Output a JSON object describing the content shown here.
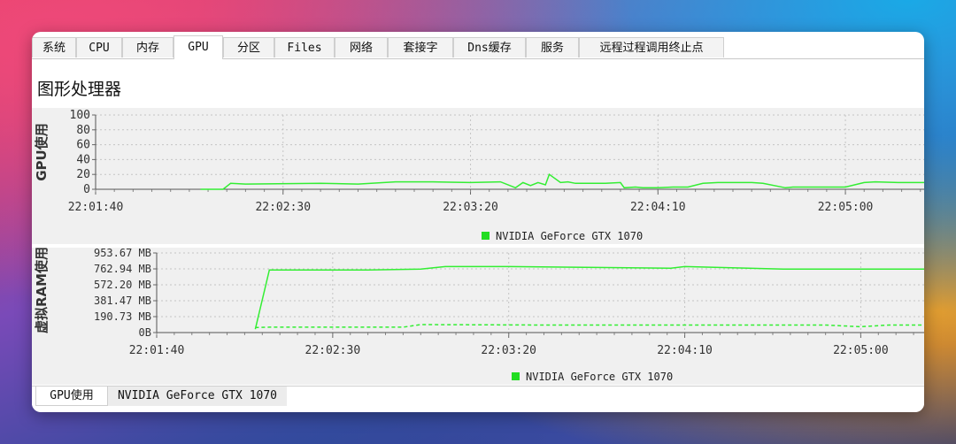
{
  "tabs": [
    {
      "label": "系统"
    },
    {
      "label": "CPU"
    },
    {
      "label": "内存"
    },
    {
      "label": "GPU"
    },
    {
      "label": "分区"
    },
    {
      "label": "Files"
    },
    {
      "label": "网络"
    },
    {
      "label": "套接字"
    },
    {
      "label": "Dns缓存"
    },
    {
      "label": "服务"
    },
    {
      "label": "远程过程调用终止点"
    }
  ],
  "active_tab": "GPU",
  "page_title": "图形处理器",
  "bottom_tabs": [
    {
      "label": "GPU使用"
    },
    {
      "label": "NVIDIA GeForce GTX 1070"
    }
  ],
  "colors": {
    "series_line": "#33ee33",
    "legend_marker": "#22dd22",
    "panel_bg": "#f0f0f0",
    "grid": "#c4c4c4"
  },
  "chart_data": [
    {
      "type": "line",
      "ylabel": "GPU使用",
      "y_ticks": [
        "100",
        "80",
        "60",
        "40",
        "20",
        "0"
      ],
      "ylim": [
        0,
        100
      ],
      "x_ticks": [
        "22:01:40",
        "22:02:30",
        "22:03:20",
        "22:04:10",
        "22:05:00"
      ],
      "x_tick_seconds": [
        0,
        50,
        100,
        150,
        200
      ],
      "xlim": [
        0,
        221
      ],
      "grid": true,
      "legend_position": "bottom-center",
      "series": [
        {
          "name": "NVIDIA GeForce GTX 1070",
          "style": "solid",
          "x": [
            28,
            34,
            36,
            40,
            60,
            70,
            80,
            90,
            100,
            108,
            112,
            114,
            116,
            118,
            120,
            121,
            124,
            126,
            128,
            136,
            140,
            141,
            144,
            146,
            150,
            154,
            158,
            162,
            166,
            170,
            175,
            178,
            184,
            186,
            190,
            200,
            205,
            208,
            214,
            221
          ],
          "y": [
            0,
            0,
            8,
            7,
            8,
            7,
            10,
            10,
            9,
            10,
            2,
            9,
            5,
            9,
            6,
            20,
            9,
            10,
            8,
            8,
            9,
            2,
            3,
            2,
            2,
            3,
            3,
            8,
            9,
            9,
            9,
            8,
            2,
            3,
            3,
            3,
            9,
            10,
            9,
            9
          ]
        }
      ]
    },
    {
      "type": "line",
      "ylabel": "虚拟RAM使用",
      "y_ticks": [
        "953.67 MB",
        "762.94 MB",
        "572.20 MB",
        "381.47 MB",
        "190.73 MB",
        "0B"
      ],
      "ylim": [
        0,
        953.67
      ],
      "ylim_unit": "MB",
      "x_ticks": [
        "22:01:40",
        "22:02:30",
        "22:03:20",
        "22:04:10",
        "22:05:00"
      ],
      "x_tick_seconds": [
        0,
        50,
        100,
        150,
        200
      ],
      "xlim": [
        0,
        218
      ],
      "grid": true,
      "legend_position": "bottom-center",
      "series": [
        {
          "name": "NVIDIA GeForce GTX 1070",
          "style": "solid",
          "x": [
            28,
            32,
            60,
            75,
            82,
            100,
            125,
            146,
            150,
            178,
            218
          ],
          "y": [
            40,
            750,
            750,
            760,
            790,
            790,
            780,
            770,
            790,
            760,
            760
          ]
        },
        {
          "name": "NVIDIA GeForce GTX 1070",
          "style": "dashed",
          "x": [
            28,
            32,
            70,
            75,
            110,
            150,
            190,
            200,
            208,
            218
          ],
          "y": [
            60,
            65,
            65,
            95,
            90,
            90,
            90,
            70,
            90,
            90
          ]
        }
      ]
    }
  ]
}
